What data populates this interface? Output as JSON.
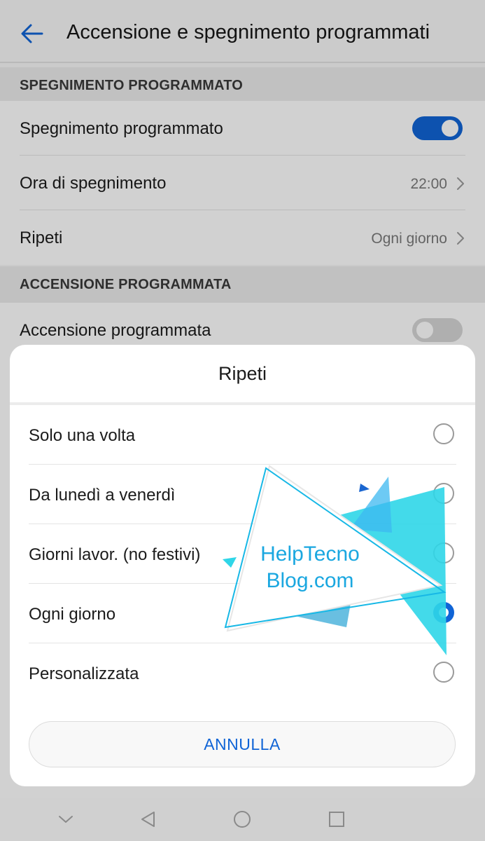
{
  "app_bar": {
    "title": "Accensione e spegnimento programmati",
    "back_icon": "arrow-left-icon"
  },
  "sections": [
    {
      "header": "SPEGNIMENTO PROGRAMMATO",
      "rows": [
        {
          "label": "Spegnimento programmato",
          "toggle": "on"
        },
        {
          "label": "Ora di spegnimento",
          "value": "22:00"
        },
        {
          "label": "Ripeti",
          "value": "Ogni giorno"
        }
      ]
    },
    {
      "header": "ACCENSIONE PROGRAMMATA",
      "rows": [
        {
          "label": "Accensione programmata",
          "toggle": "off"
        }
      ]
    }
  ],
  "dialog": {
    "title": "Ripeti",
    "options": [
      {
        "label": "Solo una volta",
        "selected": false
      },
      {
        "label": "Da lunedì a venerdì",
        "selected": false
      },
      {
        "label": "Giorni lavor. (no festivi)",
        "selected": false
      },
      {
        "label": "Ogni giorno",
        "selected": true
      },
      {
        "label": "Personalizzata",
        "selected": false
      }
    ],
    "cancel_label": "ANNULLA"
  },
  "watermark": {
    "line1": "HelpTecno",
    "line2": "Blog.com"
  },
  "nav_bar": {
    "icons": [
      "chevron-down-icon",
      "back-triangle-icon",
      "home-circle-icon",
      "recents-square-icon"
    ]
  },
  "colors": {
    "accent": "#1064d6",
    "watermark": "#1aa7e0"
  }
}
